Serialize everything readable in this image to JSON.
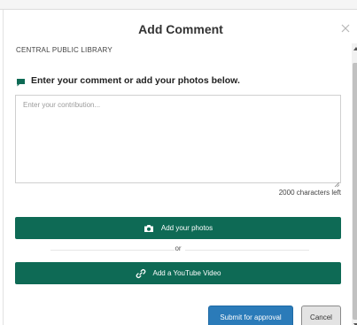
{
  "dialog": {
    "title": "Add Comment",
    "close_icon": "close-icon"
  },
  "library": {
    "name": "CENTRAL PUBLIC LIBRARY"
  },
  "prompt": {
    "icon": "comment-icon",
    "text": "Enter your comment or add your photos below."
  },
  "contribution": {
    "value": "",
    "placeholder": "Enter your contribution...",
    "chars_left": "2000 characters left"
  },
  "actions": {
    "add_photos_label": "Add your photos",
    "add_photos_icon": "camera-icon",
    "or_label": "or",
    "add_video_label": "Add a YouTube Video",
    "add_video_icon": "link-icon",
    "submit_label": "Submit for approval",
    "cancel_label": "Cancel"
  },
  "colors": {
    "primary_green": "#0e6a55",
    "submit_blue": "#2b7bb9",
    "cancel_gray": "#e3e3e3"
  }
}
